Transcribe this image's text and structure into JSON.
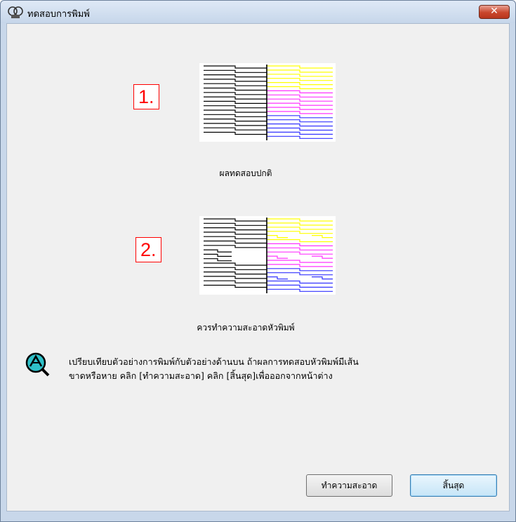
{
  "window": {
    "title": "ทดสอบการพิมพ์",
    "close_label": "✕"
  },
  "patterns": [
    {
      "number": "1.",
      "caption": "ผลทดสอบปกติ",
      "state": "normal"
    },
    {
      "number": "2.",
      "caption": "ควรทำความสะอาดหัวพิมพ์",
      "state": "needs-cleaning"
    }
  ],
  "colors": {
    "black_ink": "#000000",
    "yellow_ink": "#ffff00",
    "magenta_ink": "#ff33ff",
    "cyan_ink": "#3333ff",
    "frame_red": "#ff0000"
  },
  "hint": {
    "line1": "เปรียบเทียบตัวอย่างการพิมพ์กับตัวอย่างด้านบน ถ้าผลการทดสอบหัวพิมพ์มีเส้น",
    "line2": "ขาดหรือหาย คลิก [ทำความสะอาด] คลิก [สิ้นสุด]เพื่อออกจากหน้าต่าง"
  },
  "buttons": {
    "clean": "ทำความสะอาด",
    "finish": "สิ้นสุด"
  }
}
